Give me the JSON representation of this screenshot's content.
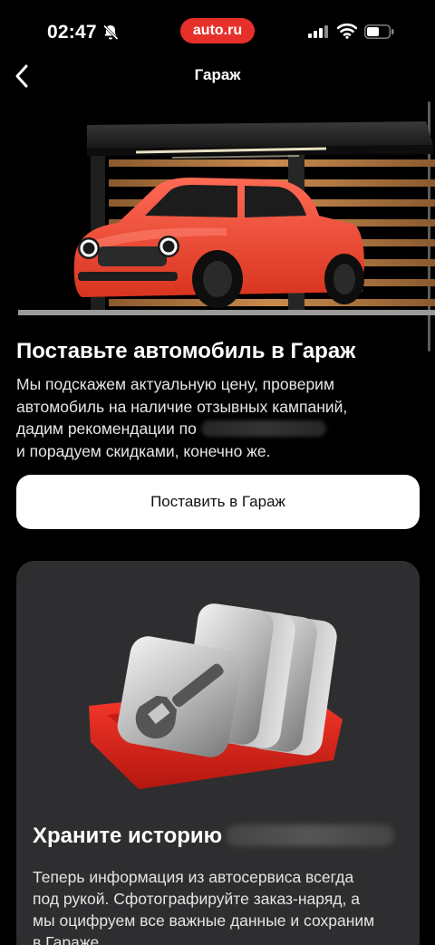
{
  "status_bar": {
    "time": "02:47",
    "brand": "auto.ru"
  },
  "nav": {
    "title": "Гараж"
  },
  "promo": {
    "title": "Поставьте автомобиль в Гараж",
    "line1": "Мы подскажем актуальную цену, проверим",
    "line2": "автомобиль на наличие отзывных кампаний,",
    "line3": "дадим рекомендации по",
    "line4": "и порадуем скидками, конечно же.",
    "button": "Поставить в Гараж"
  },
  "card": {
    "title": "Храните историю",
    "line1": "Теперь информация из автосервиса всегда",
    "line2": "под рукой. Сфотографируйте заказ-наряд, а",
    "line3": "мы оцифруем все важные данные и сохраним",
    "line4": "в Гараже"
  },
  "colors": {
    "accent": "#e8302b",
    "card_bg": "#2e2e30",
    "background": "#000000"
  },
  "icons": [
    "bell-off-icon",
    "signal-icon",
    "wifi-icon",
    "battery-icon",
    "chevron-left-icon",
    "wrench-icon"
  ]
}
